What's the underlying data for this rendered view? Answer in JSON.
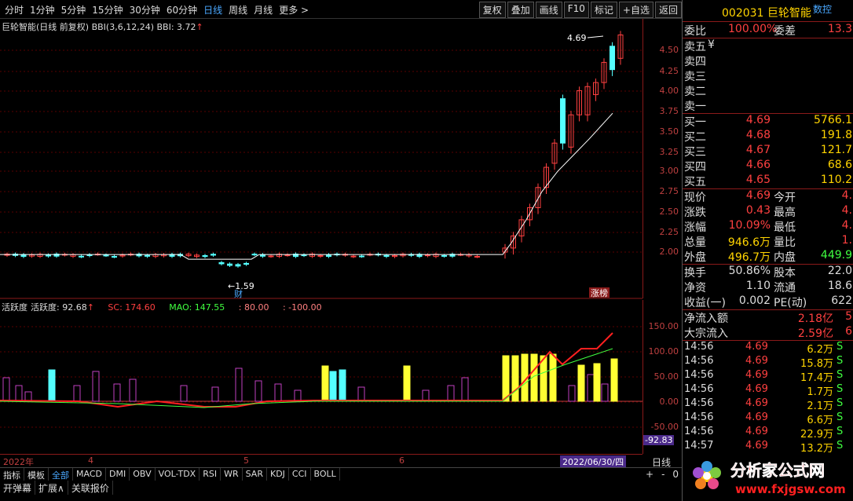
{
  "toolbar": {
    "periods": [
      "分时",
      "1分钟",
      "5分钟",
      "15分钟",
      "30分钟",
      "60分钟",
      "日线",
      "周线",
      "月线",
      "更多 >"
    ],
    "active_period": "日线",
    "tools": [
      "复权",
      "叠加",
      "画线",
      "F10",
      "标记",
      "+自选",
      "返回"
    ]
  },
  "main_chart": {
    "title": "巨轮智能(日线 前复权)",
    "bbi_params": "BBI(3,6,12,24)",
    "bbi_value": "BBI: 3.72",
    "bbi_arrow": "↑",
    "high_label": "4.69",
    "low_label": "1.59",
    "cai_label": "财",
    "zhangbang_label": "涨榜",
    "price_axis": [
      "4.50",
      "4.25",
      "4.00",
      "3.75",
      "3.50",
      "3.25",
      "3.00",
      "2.75",
      "2.50",
      "2.25",
      "2.00"
    ]
  },
  "sub_chart": {
    "name": "活跃度",
    "value": "活跃度: 92.68",
    "sc": "SC: 174.60",
    "mao": "MAO: 147.55",
    "l80": ": 80.00",
    "lm100": ": -100.00",
    "axis": [
      "150.00",
      "100.00",
      "50.00",
      "0.00",
      "-50.00"
    ],
    "bottom_value": "-92.83"
  },
  "time_axis": {
    "labels": [
      "2022年",
      "4",
      "5",
      "6"
    ],
    "date_badge": "2022/06/30/四",
    "period_label": "日线",
    "controls": [
      "+",
      "-",
      "0"
    ]
  },
  "indicator_tabs": [
    "指标",
    "模板",
    "全部",
    "MACD",
    "DMI",
    "OBV",
    "VOL-TDX",
    "RSI",
    "WR",
    "SAR",
    "KDJ",
    "CCI",
    "BOLL"
  ],
  "active_tab": "全部",
  "bottom_bar": [
    "开弹幕",
    "扩展∧",
    "关联报价"
  ],
  "quote": {
    "code": "002031",
    "name": "巨轮智能",
    "ctrl": "数控",
    "weibi_label": "委比",
    "weibi": "100.00%",
    "weicha_label": "委差",
    "weicha": "13.3",
    "sell": [
      {
        "label": "卖五",
        "note": "¥"
      },
      {
        "label": "卖四",
        "note": ""
      },
      {
        "label": "卖三",
        "note": ""
      },
      {
        "label": "卖二",
        "note": ""
      },
      {
        "label": "卖一",
        "note": ""
      }
    ],
    "buy": [
      {
        "label": "买一",
        "price": "4.69",
        "vol": "5766.1"
      },
      {
        "label": "买二",
        "price": "4.68",
        "vol": "191.8"
      },
      {
        "label": "买三",
        "price": "4.67",
        "vol": "121.7"
      },
      {
        "label": "买四",
        "price": "4.66",
        "vol": "68.6"
      },
      {
        "label": "买五",
        "price": "4.65",
        "vol": "110.2"
      }
    ],
    "stats": [
      {
        "l1": "现价",
        "v1": "4.69",
        "l2": "今开",
        "v2": "4."
      },
      {
        "l1": "涨跌",
        "v1": "0.43",
        "l2": "最高",
        "v2": "4."
      },
      {
        "l1": "涨幅",
        "v1": "10.09%",
        "l2": "最低",
        "v2": "4."
      },
      {
        "l1": "总量",
        "v1": "946.6万",
        "l2": "量比",
        "v2": "1."
      },
      {
        "l1": "外盘",
        "v1": "496.7万",
        "l2": "内盘",
        "v2": "449.9"
      }
    ],
    "stats2": [
      {
        "l1": "换手",
        "v1": "50.86%",
        "l2": "股本",
        "v2": "22.0"
      },
      {
        "l1": "净资",
        "v1": "1.10",
        "l2": "流通",
        "v2": "18.6"
      },
      {
        "l1": "收益(一)",
        "v1": "0.002",
        "l2": "PE(动)",
        "v2": "622"
      }
    ],
    "flow": [
      {
        "l": "净流入额",
        "v": "2.18亿",
        "t": "5"
      },
      {
        "l": "大宗流入",
        "v": "2.59亿",
        "t": "6"
      }
    ],
    "ticks": [
      {
        "t": "14:56",
        "p": "4.69",
        "v": "6.2万",
        "s": "S"
      },
      {
        "t": "14:56",
        "p": "4.69",
        "v": "15.8万",
        "s": "S"
      },
      {
        "t": "14:56",
        "p": "4.69",
        "v": "17.4万",
        "s": "S"
      },
      {
        "t": "14:56",
        "p": "4.69",
        "v": "1.7万",
        "s": "S"
      },
      {
        "t": "14:56",
        "p": "4.69",
        "v": "2.1万",
        "s": "S"
      },
      {
        "t": "14:56",
        "p": "4.69",
        "v": "6.6万",
        "s": "S"
      },
      {
        "t": "14:56",
        "p": "4.69",
        "v": "22.9万",
        "s": "S"
      },
      {
        "t": "14:57",
        "p": "4.69",
        "v": "13.2万",
        "s": "S"
      }
    ]
  },
  "watermark": {
    "title": "分析家公式网",
    "url": "www.fxjgsw.com"
  },
  "colors": {
    "up": "#ff4040",
    "down": "#54ffff",
    "yellow": "#ffff33",
    "purple": "#c040c0",
    "bbi": "#ffffff"
  }
}
